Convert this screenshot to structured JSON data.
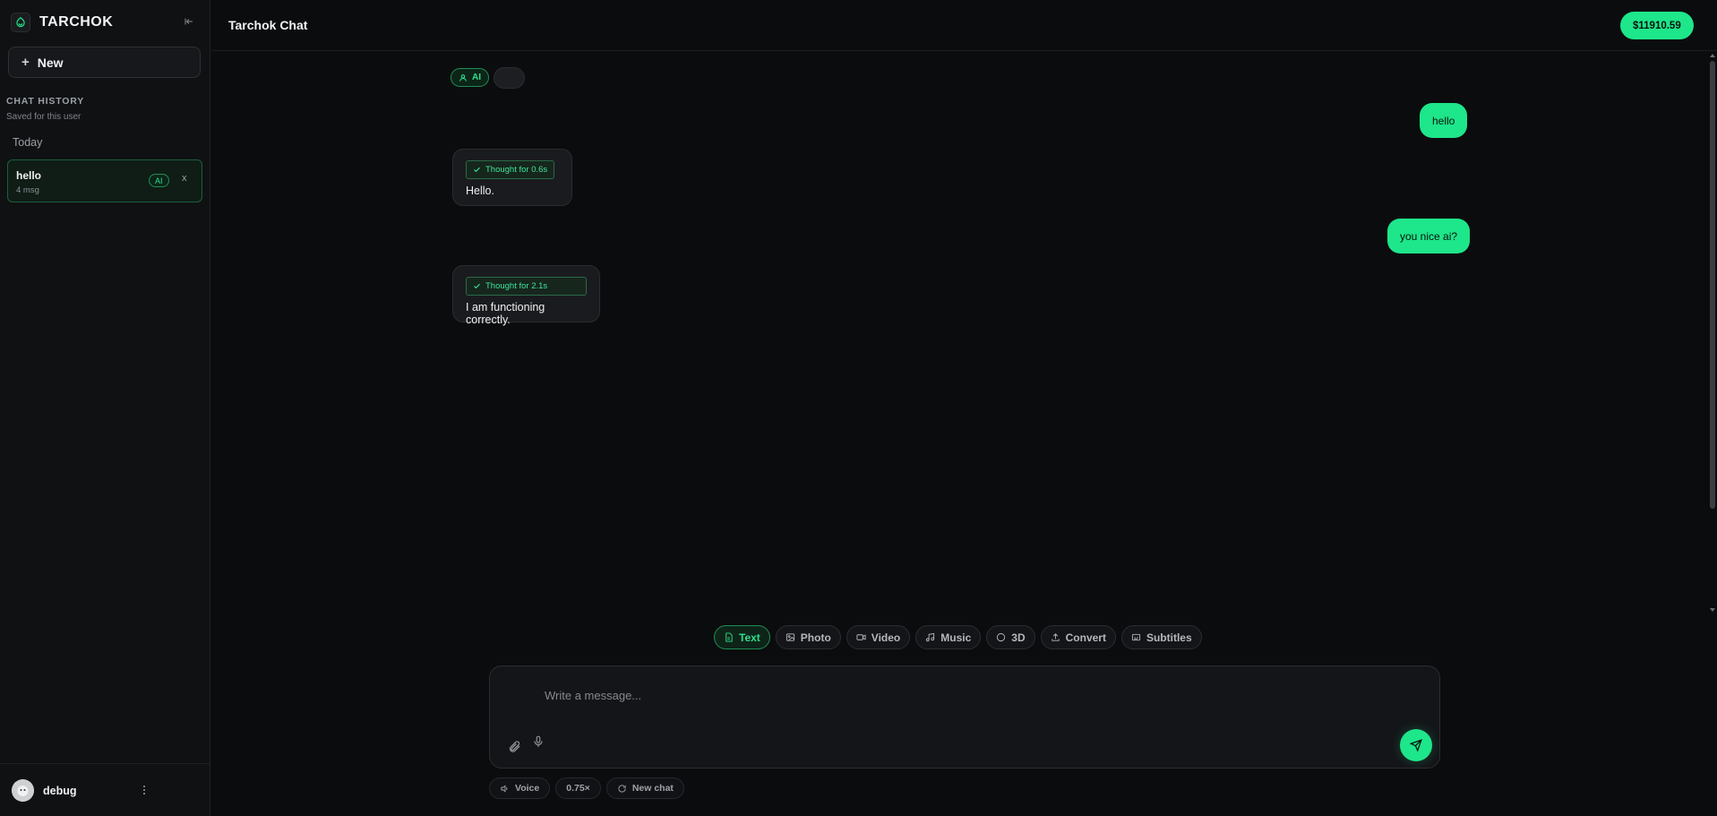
{
  "brand": {
    "name": "TARCHOK"
  },
  "sidebar": {
    "new_label": "New",
    "history_title": "CHAT HISTORY",
    "history_subtitle": "Saved for this user",
    "group_label": "Today",
    "chats": [
      {
        "title": "hello",
        "meta": "4 msg",
        "badge": "AI",
        "close": "x"
      }
    ]
  },
  "user": {
    "name": "debug"
  },
  "header": {
    "title": "Tarchok Chat",
    "balance": "$11910.59"
  },
  "chat": {
    "chip_ai": "AI",
    "messages": [
      {
        "role": "user",
        "text": "hello"
      },
      {
        "role": "ai",
        "thought": "Thought for 0.6s",
        "text": "Hello."
      },
      {
        "role": "user",
        "text": "you nice ai?"
      },
      {
        "role": "ai",
        "thought": "Thought for 2.1s",
        "text": "I am functioning correctly."
      }
    ]
  },
  "modes": [
    {
      "label": "Text",
      "icon": "document-icon",
      "active": true
    },
    {
      "label": "Photo",
      "icon": "image-icon"
    },
    {
      "label": "Video",
      "icon": "video-icon"
    },
    {
      "label": "Music",
      "icon": "music-icon"
    },
    {
      "label": "3D",
      "icon": "circle-icon"
    },
    {
      "label": "Convert",
      "icon": "upload-icon"
    },
    {
      "label": "Subtitles",
      "icon": "subtitles-icon"
    }
  ],
  "composer": {
    "placeholder": "Write a message..."
  },
  "bottom": {
    "voice": "Voice",
    "speed": "0.75×",
    "new_chat": "New chat"
  },
  "colors": {
    "accent": "#1ee68a",
    "background": "#0b0c0e",
    "panel": "#101113"
  }
}
